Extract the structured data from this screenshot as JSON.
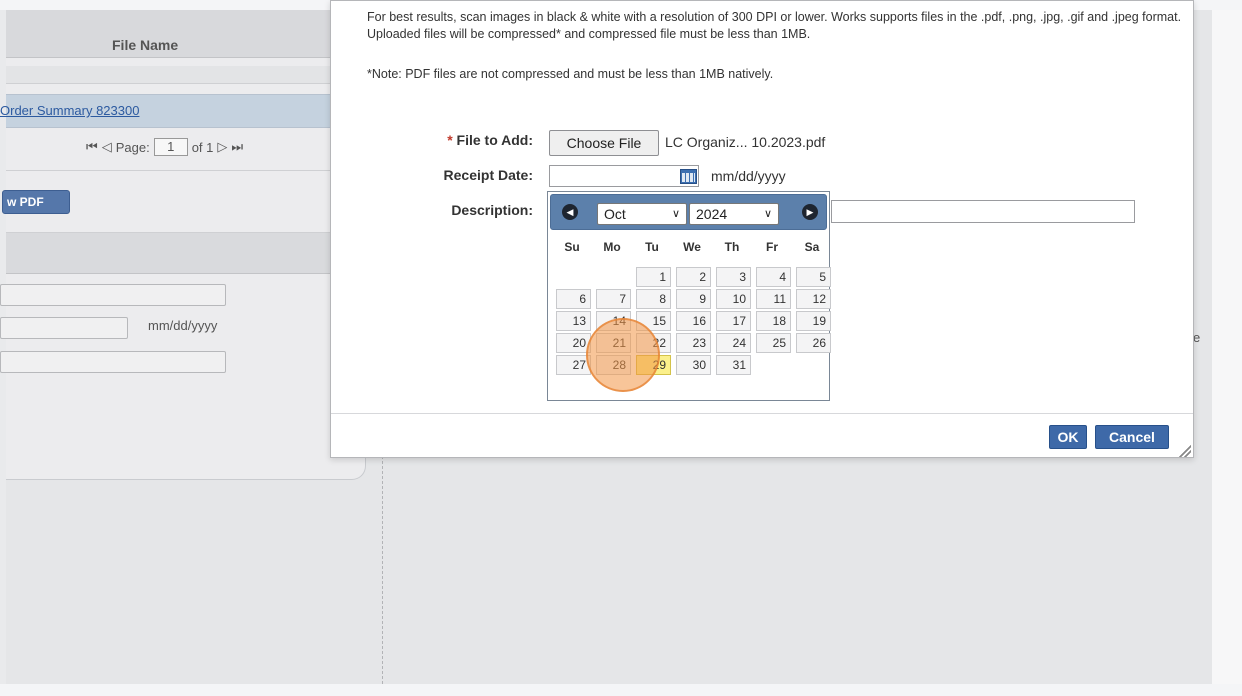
{
  "background": {
    "column_header": "File Name",
    "file_link": "Order Summary 823300",
    "pager": {
      "label": "Page:",
      "current": "1",
      "of": "of 1"
    },
    "pdf_button": "w PDF",
    "date_hint": "mm/dd/yyyy",
    "stray_char": "e"
  },
  "modal": {
    "instructions": "For best results, scan images in black & white with a resolution of 300 DPI or lower. Works supports files in the .pdf, .png, .jpg, .gif and .jpeg format. Uploaded files will be compressed* and compressed file must be less than 1MB.",
    "note": "*Note: PDF files are not compressed and must be less than 1MB natively.",
    "fields": {
      "file_required_mark": "*",
      "file_label": "File to Add:",
      "choose_file": "Choose File",
      "file_name": "LC Organiz... 10.2023.pdf",
      "receipt_label": "Receipt Date:",
      "receipt_value": "",
      "receipt_hint": "mm/dd/yyyy",
      "description_label": "Description:",
      "description_value": ""
    },
    "buttons": {
      "ok": "OK",
      "cancel": "Cancel"
    }
  },
  "calendar": {
    "month": "Oct",
    "year": "2024",
    "weekdays": [
      "Su",
      "Mo",
      "Tu",
      "We",
      "Th",
      "Fr",
      "Sa"
    ],
    "first_weekday_index": 2,
    "days_in_month": 31,
    "highlighted_day": 29,
    "colors": {
      "header": "#5c80ab",
      "today": "#fbf08b",
      "click_marker": "#f29646"
    }
  }
}
